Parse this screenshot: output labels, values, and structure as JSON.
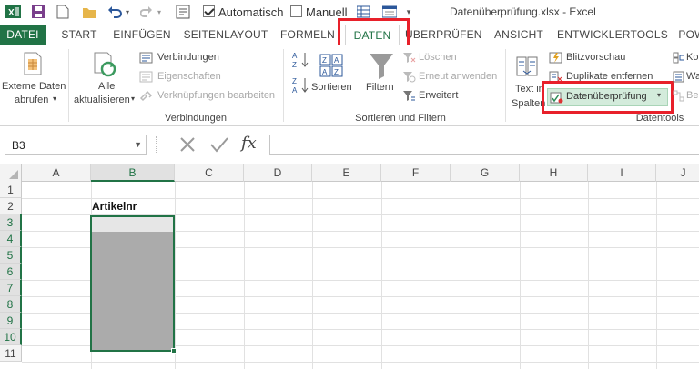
{
  "window": {
    "title": "Datenüberprüfung.xlsx - Excel"
  },
  "qat": {
    "automatic_label": "Automatisch",
    "automatic_checked": true,
    "manual_label": "Manuell",
    "manual_checked": false
  },
  "tabs": [
    {
      "label": "DATEI"
    },
    {
      "label": "START"
    },
    {
      "label": "EINFÜGEN"
    },
    {
      "label": "SEITENLAYOUT"
    },
    {
      "label": "FORMELN"
    },
    {
      "label": "DATEN"
    },
    {
      "label": "ÜBERPRÜFEN"
    },
    {
      "label": "ANSICHT"
    },
    {
      "label": "ENTWICKLERTOOLS"
    },
    {
      "label": "POW"
    }
  ],
  "ribbon": {
    "external_data": {
      "line1": "Externe Daten",
      "line2": "abrufen"
    },
    "refresh_all": {
      "line1": "Alle",
      "line2": "aktualisieren"
    },
    "connections": {
      "label": "Verbindungen"
    },
    "properties": {
      "label": "Eigenschaften"
    },
    "edit_links": {
      "label": "Verknüpfungen bearbeiten"
    },
    "group_connections": "Verbindungen",
    "sort_az": "A→Z",
    "sort_za": "Z→A",
    "sort": {
      "label": "Sortieren"
    },
    "filter": {
      "label": "Filtern"
    },
    "clear": {
      "label": "Löschen"
    },
    "reapply": {
      "label": "Erneut anwenden"
    },
    "advanced": {
      "label": "Erweitert"
    },
    "group_sort_filter": "Sortieren und Filtern",
    "text_to_columns": {
      "line1": "Text in",
      "line2": "Spalten"
    },
    "flash_fill": {
      "label": "Blitzvorschau"
    },
    "remove_duplicates": {
      "label": "Duplikate entfernen"
    },
    "data_validation": {
      "label": "Datenüberprüfung"
    },
    "consolidate": {
      "label": "Ko"
    },
    "what_if": {
      "label": "Wa"
    },
    "relationships": {
      "label": "Be"
    },
    "group_data_tools": "Datentools"
  },
  "formula_bar": {
    "name_box": "B3",
    "formula": ""
  },
  "grid": {
    "columns": [
      "A",
      "B",
      "C",
      "D",
      "E",
      "F",
      "G",
      "H",
      "I",
      "J"
    ],
    "rows": [
      "1",
      "2",
      "3",
      "4",
      "5",
      "6",
      "7",
      "8",
      "9",
      "10",
      "11"
    ],
    "selected_column": "B",
    "selected_rows": [
      "3",
      "4",
      "5",
      "6",
      "7",
      "8",
      "9",
      "10"
    ],
    "cells": {
      "B2": "Artikelnr"
    }
  },
  "colors": {
    "excel_green": "#217346",
    "highlight_red": "#e8202a",
    "selection_fill": "#ababab"
  }
}
